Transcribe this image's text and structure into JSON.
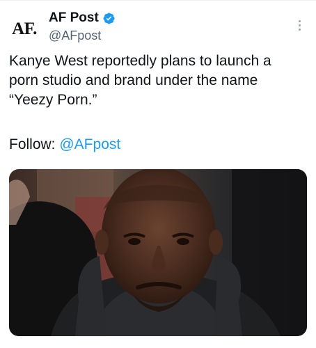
{
  "tweet": {
    "avatar_text": "AF.",
    "display_name": "AF Post",
    "handle": "@AFpost",
    "text_line_1": "Kanye West reportedly plans to launch a",
    "text_line_2": "porn studio and brand under the name",
    "text_line_3": "“Yeezy Porn.”",
    "follow_label": "Follow: ",
    "follow_mention": "@AFpost",
    "verified_icon": "verified-badge-icon",
    "more_icon": "more-vertical-icon"
  },
  "colors": {
    "text": "#0f1419",
    "secondary": "#536471",
    "link": "#1d9bf0",
    "verified": "#1d9bf0"
  }
}
